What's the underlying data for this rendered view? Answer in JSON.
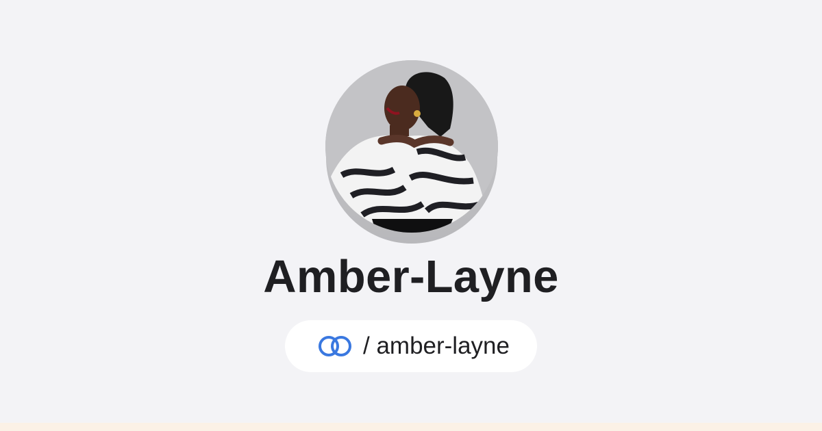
{
  "profile": {
    "display_name": "Amber-Layne",
    "handle": "/ amber-layne",
    "avatar": "profile-photo"
  },
  "icons": {
    "handle_icon": "linked-rings-icon"
  },
  "colors": {
    "background": "#f3f3f6",
    "bottom_strip": "#fbf1e6",
    "name_text": "#1f1f22",
    "pill_background": "#ffffff",
    "icon_blue": "#3a78e0"
  }
}
